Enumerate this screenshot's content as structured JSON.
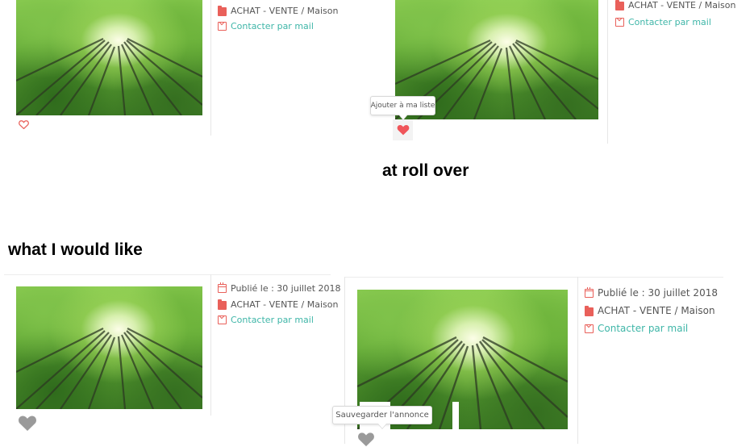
{
  "captions": {
    "rollover": "at roll over",
    "wish": "what I would like"
  },
  "listing": {
    "published": "Publié le : 30 juillet 2018",
    "category": "ACHAT - VENTE / Maison",
    "contact": "Contacter par mail"
  },
  "tooltips": {
    "current": "Ajouter à ma liste",
    "desired": "Sauvegarder l'annonce"
  },
  "icons": {
    "calendar": "calendar-icon",
    "folder": "folder-icon",
    "envelope": "envelope-icon",
    "heart": "heart-icon"
  },
  "colors": {
    "accent_red": "#e9605a",
    "link_teal": "#3fb6a8",
    "heart_active": "#f0555a",
    "heart_gray": "#9a9a9a"
  }
}
